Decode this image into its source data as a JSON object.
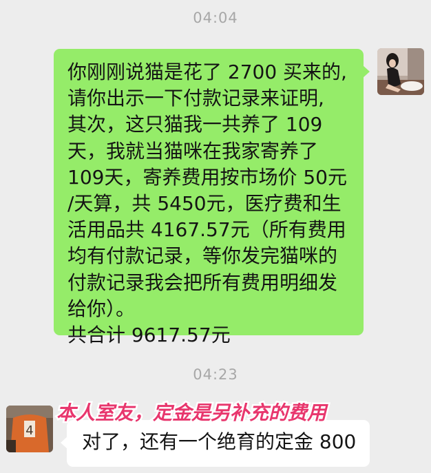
{
  "chat": {
    "timestamps": [
      "04:04",
      "04:23"
    ],
    "outgoing": {
      "lines": [
        "你刚刚说猫是花了 2700 买来的,",
        "请你出示一下付款记录来证明,",
        "其次，这只猫我一共养了 109",
        "天，我就当猫咪在我家寄养了",
        "109天，寄养费用按市场价 50元",
        "/天算，共 5450元，医疗费和生",
        "活用品共 4167.57元（所有费用",
        "均有付款记录，等你发完猫咪的",
        "付款记录我会把所有费用明细发",
        "给你）。",
        "共合计 9617.57元"
      ]
    },
    "incoming": {
      "text": "对了，还有一个绝育的定金 800"
    },
    "annotation": "本人室友，定金是另补充的费用"
  },
  "colors": {
    "background": "#ededed",
    "outgoing_bubble": "#95ec69",
    "incoming_bubble": "#ffffff",
    "timestamp": "#a7a7a7",
    "annotation": "#e8366d"
  },
  "icons": {
    "avatar_right": "user-avatar-photo-girl",
    "avatar_left": "user-avatar-photo-jersey-4"
  }
}
